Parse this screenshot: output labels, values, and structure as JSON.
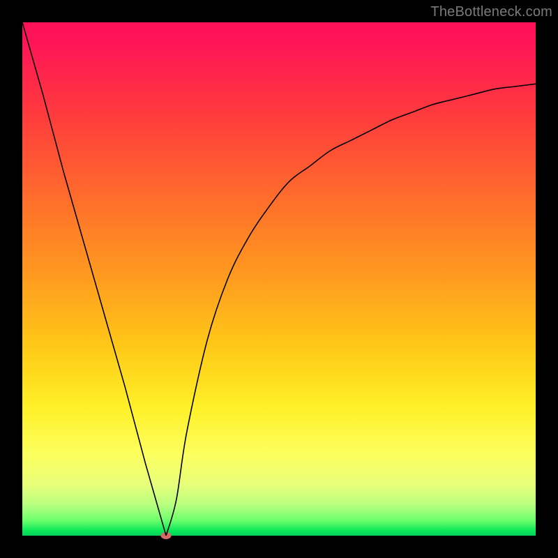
{
  "watermark": "TheBottleneck.com",
  "colors": {
    "frame": "#000000",
    "curve": "#000000",
    "dot": "#d66a6a"
  },
  "chart_data": {
    "type": "line",
    "title": "",
    "xlabel": "",
    "ylabel": "",
    "xlim": [
      0,
      100
    ],
    "ylim": [
      0,
      100
    ],
    "grid": false,
    "legend": false,
    "x": [
      0,
      4,
      8,
      12,
      16,
      20,
      24,
      26,
      28,
      30,
      32,
      36,
      40,
      44,
      48,
      52,
      56,
      60,
      64,
      68,
      72,
      76,
      80,
      84,
      88,
      92,
      96,
      100
    ],
    "values": [
      100,
      86,
      71,
      57,
      43,
      29,
      14,
      7,
      0,
      7,
      20,
      38,
      50,
      58,
      64,
      69,
      72,
      75,
      77,
      79,
      81,
      82.5,
      84,
      85,
      86,
      87,
      87.5,
      88
    ],
    "marker": {
      "x": 28,
      "y": 0
    },
    "note": "Values are read off a tickless gradient plot; x and y are normalized to a 0–100 range. The curve drops linearly from (0,100) to a minimum at x≈28, then rises with a decelerating slope approaching ~88 at x=100."
  }
}
